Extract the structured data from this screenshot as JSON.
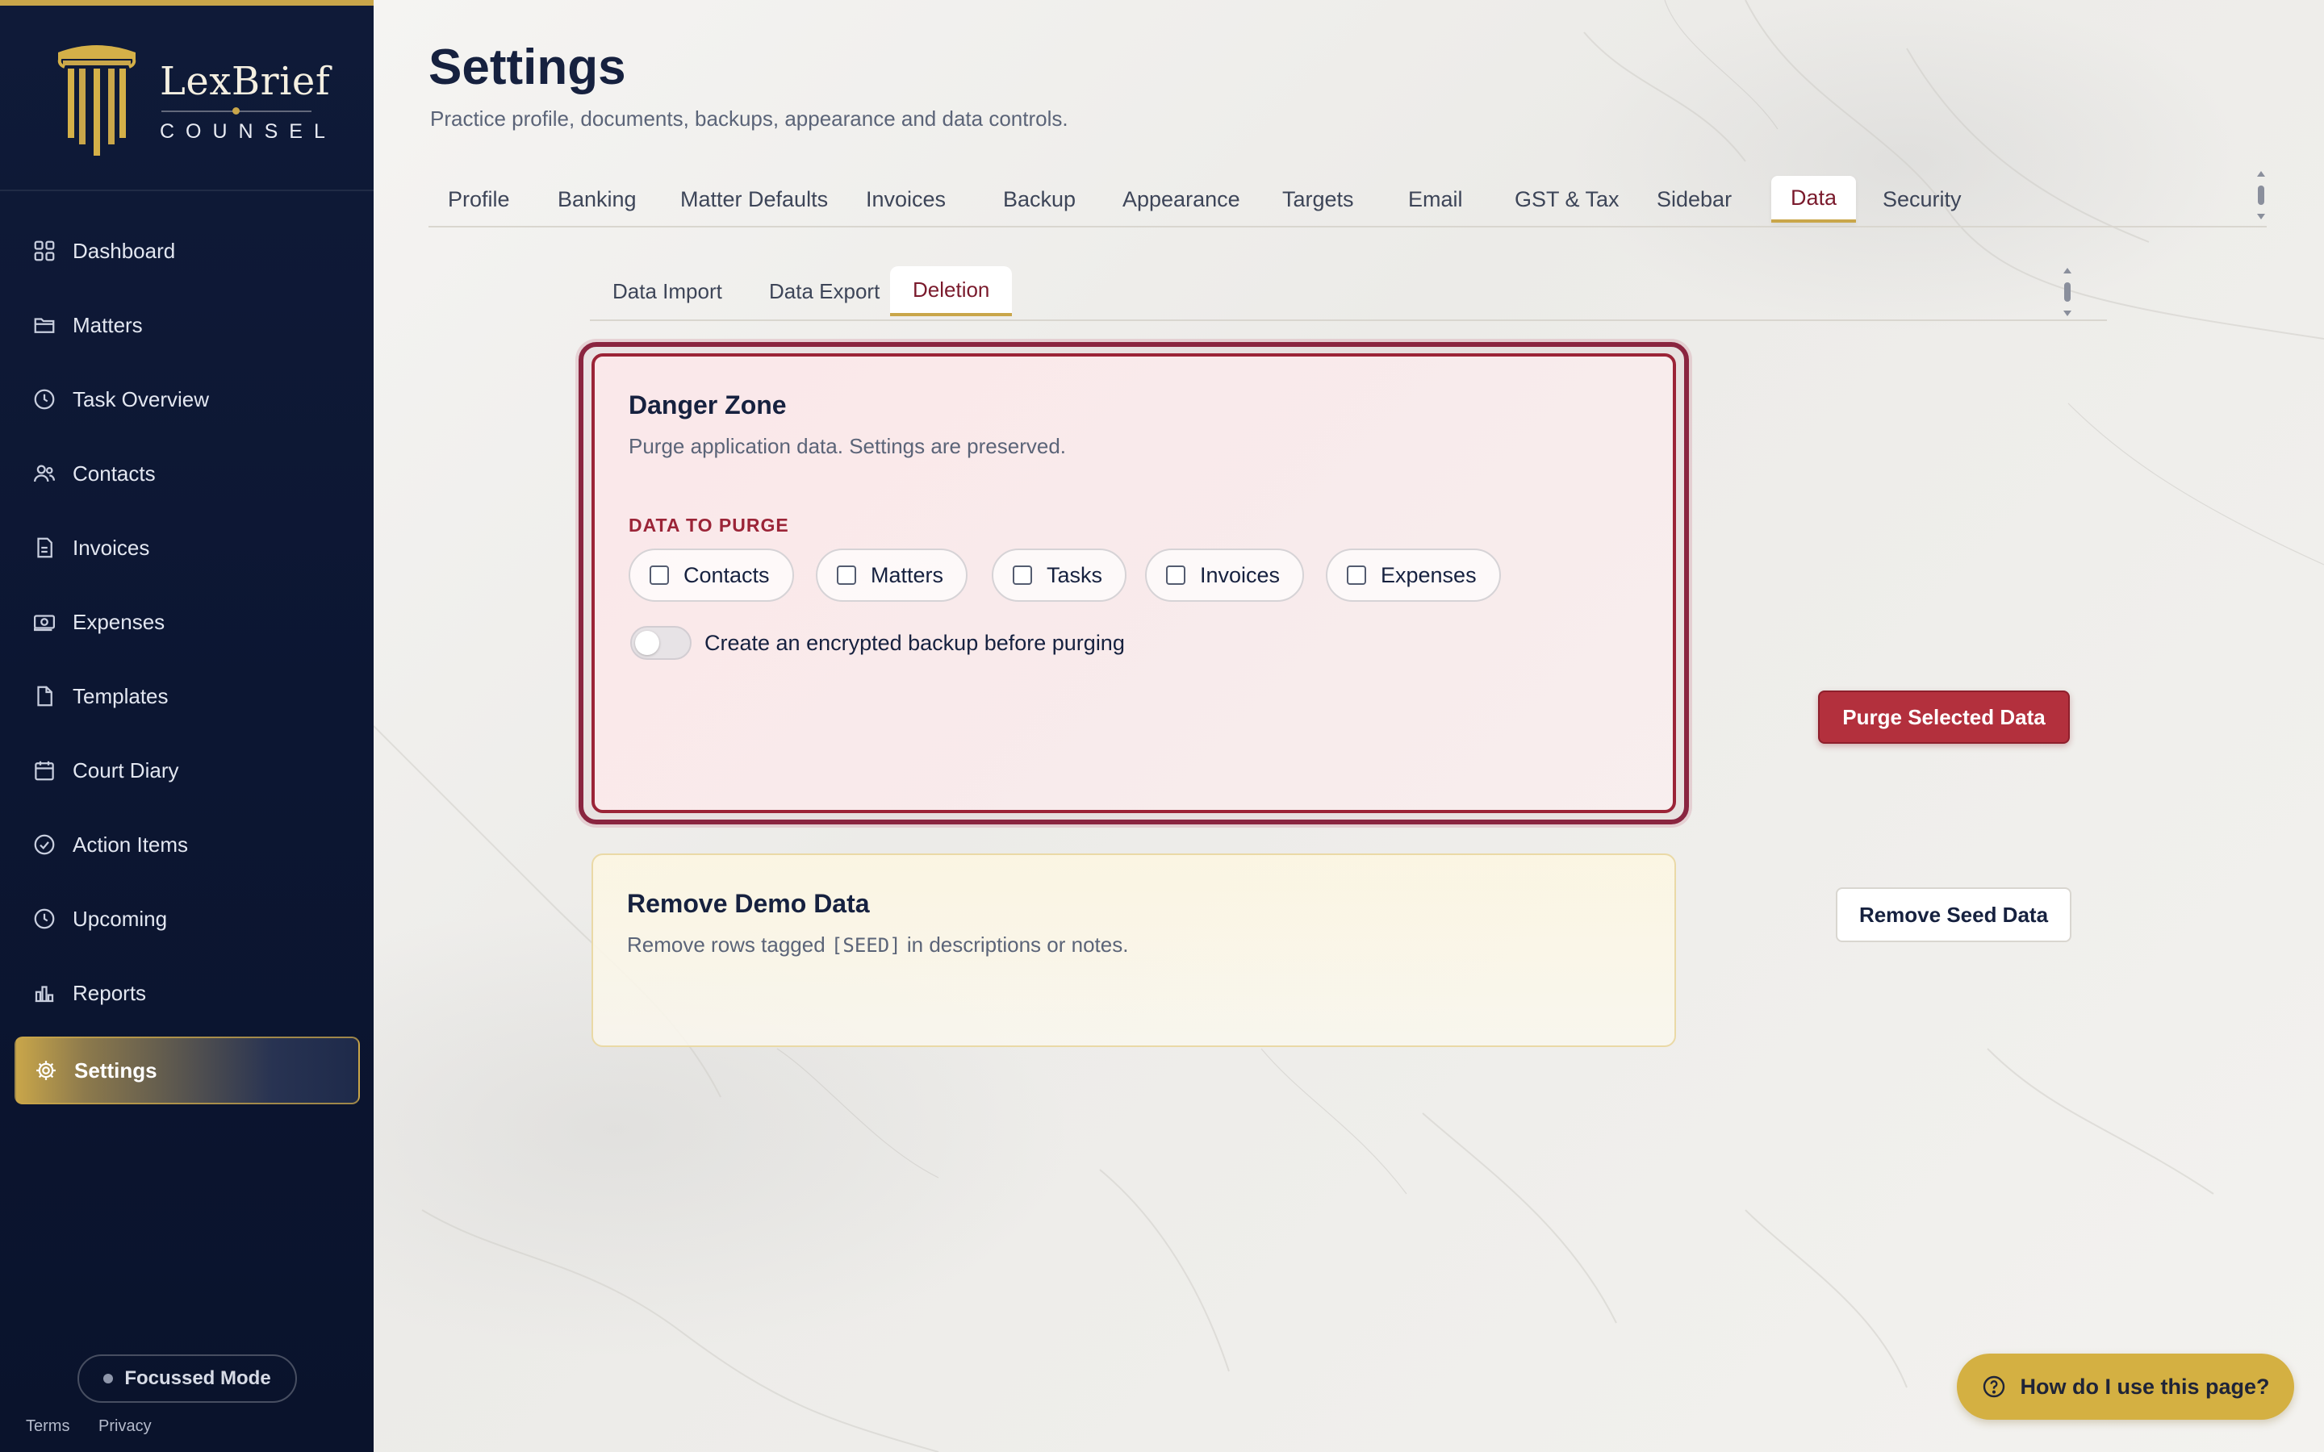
{
  "brand": {
    "name": "LexBrief",
    "subtitle": "COUNSEL"
  },
  "sidebar": {
    "items": [
      {
        "label": "Dashboard",
        "icon": "grid-icon"
      },
      {
        "label": "Matters",
        "icon": "folder-icon"
      },
      {
        "label": "Task Overview",
        "icon": "clock-icon"
      },
      {
        "label": "Contacts",
        "icon": "users-icon"
      },
      {
        "label": "Invoices",
        "icon": "invoice-icon"
      },
      {
        "label": "Expenses",
        "icon": "banknote-icon"
      },
      {
        "label": "Templates",
        "icon": "file-icon"
      },
      {
        "label": "Court Diary",
        "icon": "calendar-icon"
      },
      {
        "label": "Action Items",
        "icon": "check-circle-icon"
      },
      {
        "label": "Upcoming",
        "icon": "clock-icon"
      },
      {
        "label": "Reports",
        "icon": "bar-chart-icon"
      },
      {
        "label": "Settings",
        "icon": "gear-icon",
        "active": true
      }
    ],
    "focus_mode": "Focussed Mode",
    "footer_links": [
      "Terms",
      "Privacy"
    ]
  },
  "header": {
    "title": "Settings",
    "subtitle": "Practice profile, documents, backups, appearance and data controls."
  },
  "tabs": [
    {
      "label": "Profile"
    },
    {
      "label": "Banking"
    },
    {
      "label": "Matter Defaults"
    },
    {
      "label": "Invoices"
    },
    {
      "label": "Backup"
    },
    {
      "label": "Appearance"
    },
    {
      "label": "Targets"
    },
    {
      "label": "Email"
    },
    {
      "label": "GST & Tax"
    },
    {
      "label": "Sidebar"
    },
    {
      "label": "Data",
      "active": true
    },
    {
      "label": "Security"
    }
  ],
  "subtabs": [
    {
      "label": "Data Import"
    },
    {
      "label": "Data Export"
    },
    {
      "label": "Deletion",
      "active": true
    }
  ],
  "danger_zone": {
    "title": "Danger Zone",
    "subtitle": "Purge application data. Settings are preserved.",
    "section_label": "DATA TO PURGE",
    "options": [
      {
        "label": "Contacts",
        "checked": false
      },
      {
        "label": "Matters",
        "checked": false
      },
      {
        "label": "Tasks",
        "checked": false
      },
      {
        "label": "Invoices",
        "checked": false
      },
      {
        "label": "Expenses",
        "checked": false
      }
    ],
    "backup_toggle_label": "Create an encrypted backup before purging",
    "backup_toggle_on": false,
    "purge_button": "Purge Selected Data"
  },
  "demo_data": {
    "title": "Remove Demo Data",
    "subtitle_before": "Remove rows tagged",
    "subtitle_code": "[SEED]",
    "subtitle_after": "in descriptions or notes.",
    "button": "Remove Seed Data"
  },
  "help": {
    "label": "How do I use this page?",
    "icon": "question-circle-icon"
  },
  "colors": {
    "sidebar_bg": "#0f1a38",
    "accent_gold": "#c9a64a",
    "danger": "#b3303d",
    "danger_border": "#8a2540"
  }
}
